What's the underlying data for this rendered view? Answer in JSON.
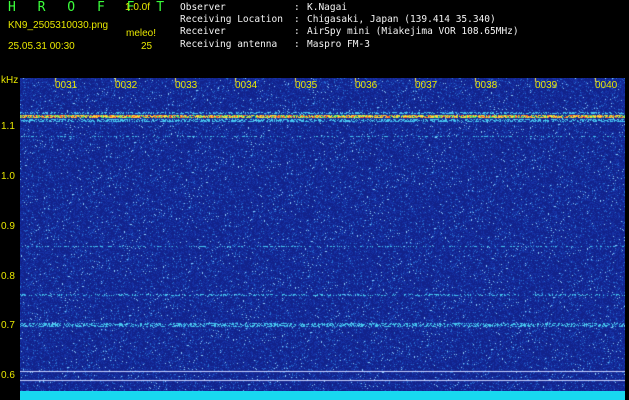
{
  "header": {
    "app_title": "H R O F F T",
    "version": "1.0.0f",
    "filename": "KN9_2505310030.png",
    "meleor_label": "meleo!",
    "datetime": "25.05.31 00:30",
    "count": "25"
  },
  "info": [
    {
      "label": "Observer",
      "value": "K.Nagai"
    },
    {
      "label": "Receiving Location",
      "value": "Chigasaki, Japan (139.414 35.340)"
    },
    {
      "label": "Receiver",
      "value": "AirSpy mini (Miakejima VOR 108.65MHz)"
    },
    {
      "label": "Receiving antenna",
      "value": "Maspro FM-3"
    }
  ],
  "waterfall": {
    "unit": "kHz",
    "y_ticks": [
      "1.1",
      "1.0",
      "0.9",
      "0.8",
      "0.7",
      "0.6"
    ],
    "x_ticks": [
      "0031",
      "0032",
      "0033",
      "0034",
      "0035",
      "0036",
      "0037",
      "0038",
      "0039",
      "0040"
    ],
    "colors": {
      "noise_bg": "#1a2f9a",
      "carrier": "#ffe040",
      "bottom_bar": "#18d8f0",
      "label": "#e8e800"
    }
  }
}
